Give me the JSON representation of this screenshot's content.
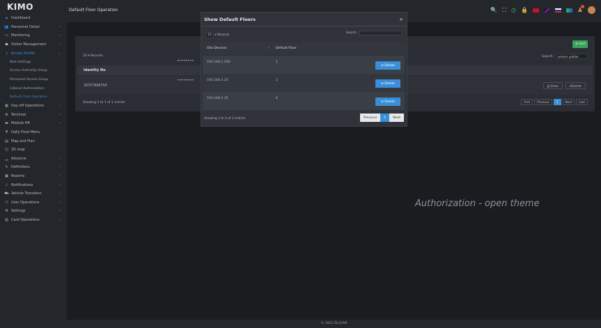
{
  "app": {
    "logo": "KIMO",
    "page_title": "Default Floor Operation",
    "footer": "© 2022 ÖLÇSAN",
    "watermark": "Authorization - open theme"
  },
  "sidebar": {
    "items": [
      {
        "label": "Dashboard",
        "icon": "home-icon",
        "glyph": "⌂"
      },
      {
        "label": "Personnel Detail",
        "icon": "users-icon",
        "glyph": "👥",
        "chev": "›"
      },
      {
        "label": "Monitoring",
        "icon": "monitor-icon",
        "glyph": "▭",
        "chev": "›"
      },
      {
        "label": "Visitor Management",
        "icon": "visitor-icon",
        "glyph": "☗",
        "chev": "›"
      },
      {
        "label": "Access Profile",
        "icon": "key-icon",
        "glyph": "⚷",
        "chev": "⌄"
      }
    ],
    "subitems": [
      "Role Settings",
      "Access Authority Group",
      "Personnel Access Group",
      "Cabinet Authorization",
      "Default Floor Operation"
    ],
    "items2": [
      {
        "label": "Day-off Operations",
        "icon": "calendar-icon",
        "glyph": "▦",
        "chev": "›"
      },
      {
        "label": "Terminal",
        "icon": "gear-icon",
        "glyph": "⚙",
        "chev": "›"
      },
      {
        "label": "Module HR",
        "icon": "hr-icon",
        "glyph": "▬",
        "chev": "›"
      },
      {
        "label": "Daily Food Menu",
        "icon": "food-icon",
        "glyph": "¶"
      },
      {
        "label": "Map and Plan",
        "icon": "map-icon",
        "glyph": "▤"
      },
      {
        "label": "3D map",
        "icon": "cube-icon",
        "glyph": "◫"
      },
      {
        "label": "Advance",
        "icon": "chart-icon",
        "glyph": "▁",
        "chev": "›"
      },
      {
        "label": "Definitions",
        "icon": "pencil-icon",
        "glyph": "✎",
        "chev": "›"
      },
      {
        "label": "Reports",
        "icon": "report-icon",
        "glyph": "▣",
        "chev": "›"
      },
      {
        "label": "Notifications",
        "icon": "bell-icon",
        "glyph": "♪",
        "chev": "›"
      },
      {
        "label": "Vehicle Transition",
        "icon": "car-icon",
        "glyph": "⛟",
        "chev": "›"
      },
      {
        "label": "User Operations",
        "icon": "user-ops-icon",
        "glyph": "⚇",
        "chev": "›"
      },
      {
        "label": "Settings",
        "icon": "wrench-icon",
        "glyph": "⚒",
        "chev": "›"
      },
      {
        "label": "Card Operations",
        "icon": "card-icon",
        "glyph": "▥",
        "chev": "›"
      }
    ]
  },
  "topbar": {
    "icons": [
      "search-icon",
      "expand-icon",
      "clock-icon",
      "lock-icon"
    ],
    "search_glyph": "🔍",
    "expand_glyph": "⛶",
    "clock_glyph": "◷",
    "lock_glyph": "🔒"
  },
  "panel": {
    "add_label": "⊕ Add",
    "records_text": "10   ▾  Records",
    "search_label": "Search:",
    "search_value": "serhan yaltılar",
    "column_header": "Identity No",
    "row_value": "33757999754",
    "show_label": "⎙ Show",
    "delete_label": "⊖Delete",
    "info": "Showing 1 to 1 of 1 entries",
    "pager": [
      "First",
      "Previous",
      "1",
      "Next",
      "Last"
    ],
    "dots": "••••••••"
  },
  "modal": {
    "title": "Show Default Floors",
    "close": "×",
    "records_size": "10",
    "records_label": "▾  Records",
    "search_label": "Search:",
    "col_device": "Otis Devices",
    "col_floor": "Default Floor",
    "sort_glyph": "↑",
    "rows": [
      {
        "device": "192.168.1.250",
        "floor": "1"
      },
      {
        "device": "192.168.2.25",
        "floor": "2"
      },
      {
        "device": "192.168.2.35",
        "floor": "6"
      }
    ],
    "delete_label": "⊖ Delete",
    "info": "Showing 1 to 3 of 3 entries",
    "pager": [
      "Previous",
      "1",
      "Next"
    ]
  }
}
